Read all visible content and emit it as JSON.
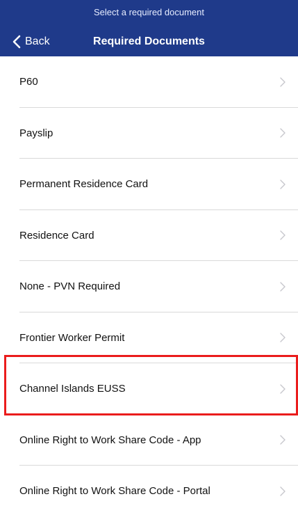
{
  "header": {
    "prompt": "Select a required document",
    "back_label": "Back",
    "title": "Required Documents",
    "background_color": "#1f3a8a"
  },
  "documents": [
    {
      "label": "P60"
    },
    {
      "label": "Payslip"
    },
    {
      "label": "Permanent Residence Card"
    },
    {
      "label": "Residence Card"
    },
    {
      "label": "None - PVN Required"
    },
    {
      "label": "Frontier Worker Permit"
    },
    {
      "label": "Channel Islands EUSS"
    },
    {
      "label": "Online Right to Work Share Code - App"
    },
    {
      "label": "Online Right to Work Share Code - Portal"
    }
  ],
  "icons": {
    "back": "chevron-left-icon",
    "row": "chevron-right-icon"
  },
  "highlight": {
    "item": "Channel Islands EUSS",
    "color": "#ea1c1c"
  }
}
